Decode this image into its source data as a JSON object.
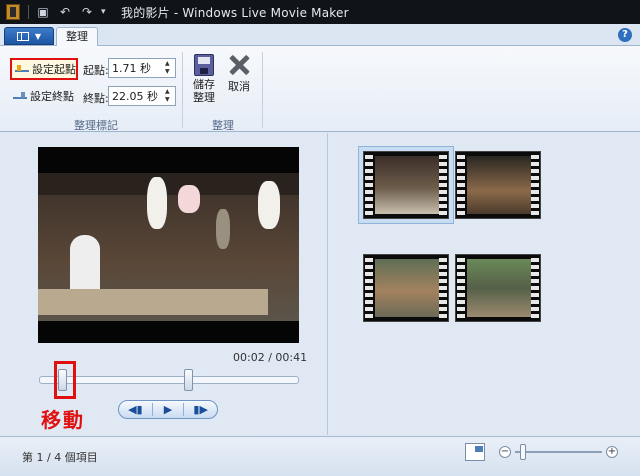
{
  "window": {
    "title": "我的影片 - Windows Live Movie Maker"
  },
  "ribbon": {
    "tab": "整理",
    "trim_tools": {
      "set_start_label": "設定起點",
      "set_end_label": "設定終點",
      "start_point_label": "起點:",
      "start_point_value": "1.71 秒",
      "end_point_label": "終點:",
      "end_point_value": "22.05 秒",
      "group_label": "整理標記"
    },
    "trim": {
      "save_label": "儲存\n整理",
      "cancel_label": "取消",
      "group_label": "整理"
    }
  },
  "player": {
    "timecode": "00:02 / 00:41",
    "trim_start_fraction": 0.0415,
    "trim_end_fraction": 0.5366,
    "annotation": "移動",
    "controls": [
      "prev-frame",
      "play",
      "next-frame"
    ]
  },
  "storyboard": {
    "clips": [
      {
        "selected": true
      },
      {
        "selected": false
      },
      {
        "selected": false
      },
      {
        "selected": false
      }
    ]
  },
  "status": {
    "text": "第 1 / 4 個項目",
    "zoom_level": 0.1
  },
  "icons": [
    "app-icon",
    "save-quick-icon",
    "undo-icon",
    "redo-icon",
    "help-icon",
    "save-trim-icon",
    "cancel-icon",
    "zoom-out-icon",
    "zoom-in-icon"
  ],
  "colors": {
    "annotation": "#e01010",
    "accent": "#1c56a4"
  }
}
